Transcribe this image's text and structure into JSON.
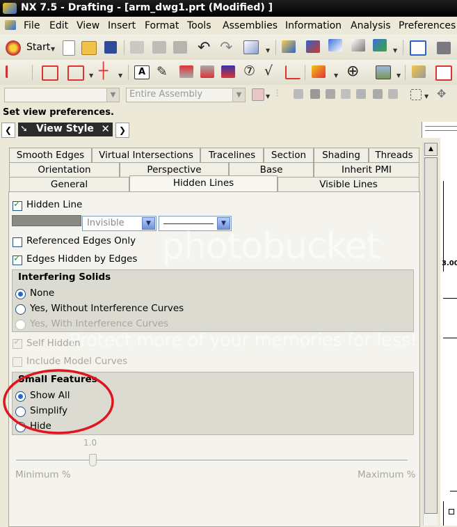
{
  "window": {
    "title": "NX 7.5 - Drafting - [arm_dwg1.prt (Modified) ]"
  },
  "menu": {
    "items": [
      "File",
      "Edit",
      "View",
      "Insert",
      "Format",
      "Tools",
      "Assemblies",
      "Information",
      "Analysis",
      "Preferences"
    ]
  },
  "toolbar": {
    "start_label": "Start"
  },
  "selection_bar": {
    "filter_value": "",
    "scope_value": "Entire Assembly"
  },
  "status": {
    "cue_line": "Set view preferences."
  },
  "dialog": {
    "title": "View Style",
    "tabs_row1": [
      "Smooth Edges",
      "Virtual Intersections",
      "Tracelines",
      "Section",
      "Shading",
      "Threads"
    ],
    "tabs_row2": [
      "Orientation",
      "Perspective",
      "Base",
      "Inherit PMI"
    ],
    "tabs_row3": [
      "General",
      "Hidden Lines",
      "Visible Lines"
    ],
    "active_tab": "Hidden Lines",
    "hidden_line": {
      "label": "Hidden Line",
      "checked": true,
      "font_value": "Invisible"
    },
    "referenced_edges": {
      "label": "Referenced Edges Only",
      "checked": false
    },
    "edges_hidden": {
      "label": "Edges Hidden by Edges",
      "checked": true
    },
    "interfering": {
      "heading": "Interfering Solids",
      "options": [
        {
          "label": "None",
          "selected": true,
          "enabled": true
        },
        {
          "label": "Yes, Without Interference Curves",
          "selected": false,
          "enabled": true
        },
        {
          "label": "Yes, With Interference Curves",
          "selected": false,
          "enabled": false
        }
      ]
    },
    "self_hidden": {
      "label": "Self Hidden",
      "checked": true,
      "enabled": false
    },
    "include_model_curves": {
      "label": "Include Model Curves",
      "checked": false,
      "enabled": false
    },
    "small_features": {
      "heading": "Small Features",
      "options": [
        {
          "label": "Show All",
          "selected": true
        },
        {
          "label": "Simplify",
          "selected": false
        },
        {
          "label": "Hide",
          "selected": false
        }
      ]
    },
    "slider": {
      "value_label": "1.0",
      "min_label": "Minimum %",
      "max_label": "Maximum %",
      "position": 0.19
    }
  },
  "drawing": {
    "dimension_text": "3.00"
  },
  "watermark": {
    "brand": "photobucket",
    "tagline": "Protect more of your memories for less!"
  },
  "colors": {
    "annotation_circle": "#e0141e",
    "title_bar": "#000000",
    "radio_accent": "#2a68c8"
  }
}
